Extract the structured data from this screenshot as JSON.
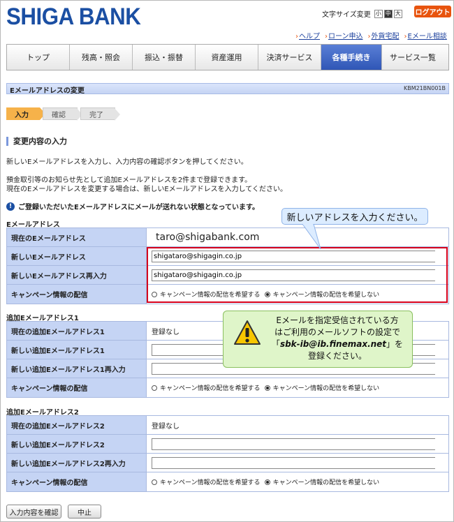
{
  "header": {
    "logo": "SHIGA BANK",
    "font_size_label": "文字サイズ変更",
    "font_sizes": [
      "小",
      "中",
      "大"
    ],
    "font_size_active": 1,
    "logout": "ログアウト",
    "links": [
      "ヘルプ",
      "ローン申込",
      "外貨宅配",
      "Eメール相談"
    ]
  },
  "nav": {
    "tabs": [
      "トップ",
      "残高・照会",
      "振込・振替",
      "資産運用",
      "決済サービス",
      "各種手続き",
      "サービス一覧"
    ],
    "active": 5
  },
  "page": {
    "title": "Eメールアドレスの変更",
    "code": "KBM21BN001B"
  },
  "steps": [
    "入力",
    "確認",
    "完了"
  ],
  "section_title": "変更内容の入力",
  "instructions": {
    "line1": "新しいEメールアドレスを入力し、入力内容の確認ボタンを押してください。",
    "line2": "預金取引等のお知らせ先として追加Eメールアドレスを2件まで登録できます。",
    "line3": "現在のEメールアドレスを変更する場合は、新しいEメールアドレスを入力してください。"
  },
  "notice": "ご登録いただいたEメールアドレスにメールが送れない状態となっています。",
  "email": {
    "label": "Eメールアドレス",
    "current_label": "現在のEメールアドレス",
    "current_value": "taro@shigabank.com",
    "new_label": "新しいEメールアドレス",
    "new_value": "shigataro@shigagin.co.jp",
    "confirm_label": "新しいEメールアドレス再入力",
    "confirm_value": "shigataro@shigagin.co.jp",
    "campaign_label": "キャンペーン情報の配信"
  },
  "radio": {
    "want": "キャンペーン情報の配信を希望する",
    "not_want": "キャンペーン情報の配信を希望しない"
  },
  "add1": {
    "label": "追加Eメールアドレス1",
    "current_label": "現在の追加Eメールアドレス1",
    "current_value": "登録なし",
    "new_label": "新しい追加Eメールアドレス1",
    "confirm_label": "新しい追加Eメールアドレス1再入力",
    "campaign_label": "キャンペーン情報の配信"
  },
  "add2": {
    "label": "追加Eメールアドレス2",
    "current_label": "現在の追加Eメールアドレス2",
    "current_value": "登録なし",
    "new_label": "新しい追加Eメールアドレス2",
    "confirm_label": "新しい追加Eメールアドレス2再入力",
    "campaign_label": "キャンペーン情報の配信"
  },
  "callouts": {
    "input_hint": "新しいアドレスを入力ください。",
    "warn_line1": "Eメールを指定受信されている方",
    "warn_line2": "はご利用のメールソフトの設定で",
    "warn_addr": "sbk-ib@ib.finemax.net",
    "warn_line3a": "「",
    "warn_line3b": "」を",
    "warn_line4": "登録ください。"
  },
  "buttons": {
    "confirm": "入力内容を確認",
    "cancel": "中止"
  },
  "colors": {
    "brand": "#1b4fa3",
    "logout": "#e8540e",
    "active_tab": "#2f56b6",
    "highlight": "#d6001c"
  }
}
